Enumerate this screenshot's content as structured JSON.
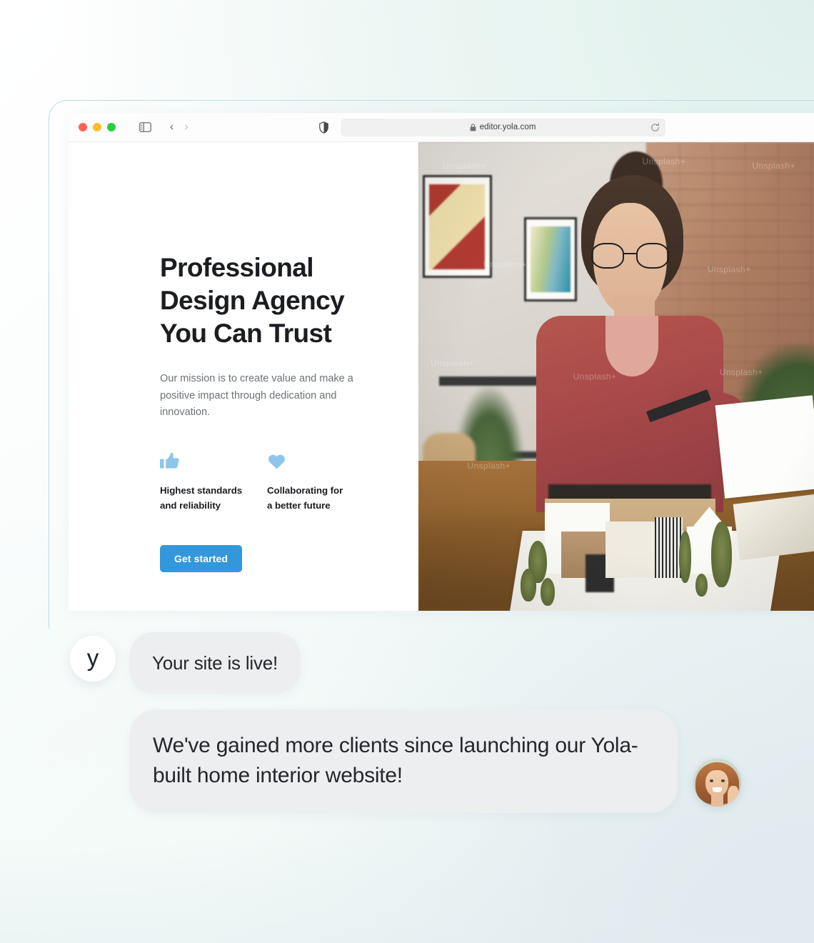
{
  "browser": {
    "window_controls": [
      "close",
      "minimize",
      "maximize"
    ],
    "sidebar_toggle": "sidebar-toggle-icon",
    "back_label": "‹",
    "forward_label": "›",
    "shield_icon": "shield-icon",
    "lock_icon": "🔒",
    "url": "editor.yola.com",
    "reload_icon": "reload-icon"
  },
  "site": {
    "title": "Professional\nDesign Agency\nYou Can Trust",
    "subtitle": "Our mission is to create value and make a positive impact through dedication and innovation.",
    "features": [
      {
        "icon": "thumbs-up-icon",
        "label": "Highest standards\nand reliability"
      },
      {
        "icon": "heart-icon",
        "label": "Collaborating for\na better future"
      }
    ],
    "cta_label": "Get started",
    "photo_alt": "Woman in red shirt reviewing architectural model in studio",
    "photo_watermarks": [
      "Unsplash+",
      "Unsplash+",
      "Unsplash+",
      "Unsplash+",
      "Unsplash+",
      "Unsplash+",
      "Unsplash+",
      "Unsplash+",
      "Unsplash+",
      "Unsplash+"
    ]
  },
  "chat": {
    "brand_initial": "y",
    "messages": [
      {
        "from": "yola",
        "text": "Your site is live!"
      },
      {
        "from": "customer",
        "text": "We've gained more clients since launching our Yola-built home interior website!"
      }
    ],
    "customer_avatar_alt": "Smiling woman with auburn hair"
  },
  "colors": {
    "accent_blue": "#3398db",
    "icon_blue": "#8ec5ea",
    "heading": "#1b1d21",
    "body_text": "#6c7178",
    "bubble_bg": "#edeef0",
    "window_border": "#b9dcee"
  }
}
